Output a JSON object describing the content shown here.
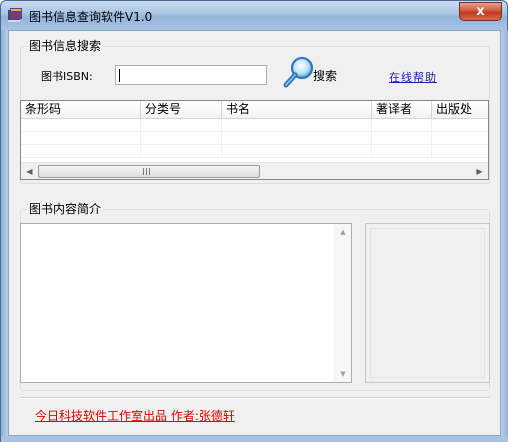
{
  "window": {
    "title": "图书信息查询软件V1.0",
    "close_glyph": "x"
  },
  "search_group": {
    "legend": "图书信息搜索",
    "isbn_label": "图书ISBN:",
    "isbn_value": "",
    "search_label": "搜索",
    "help_link": "在线帮助"
  },
  "book_list": {
    "columns": [
      "条形码",
      "分类号",
      "书名",
      "著译者",
      "出版处"
    ],
    "scroll_grip": "III",
    "arrow_left": "◀",
    "arrow_right": "▶"
  },
  "content_group": {
    "legend": "图书内容简介",
    "arrow_up": "▲",
    "arrow_down": "▼"
  },
  "footer": {
    "credit": "今日科技软件工作室出品   作者:张德轩"
  },
  "colors": {
    "accent_link": "#1b1bb3",
    "credit_red": "#e00000",
    "title_bar": "#a8c4e4",
    "close_button": "#c0391f"
  }
}
